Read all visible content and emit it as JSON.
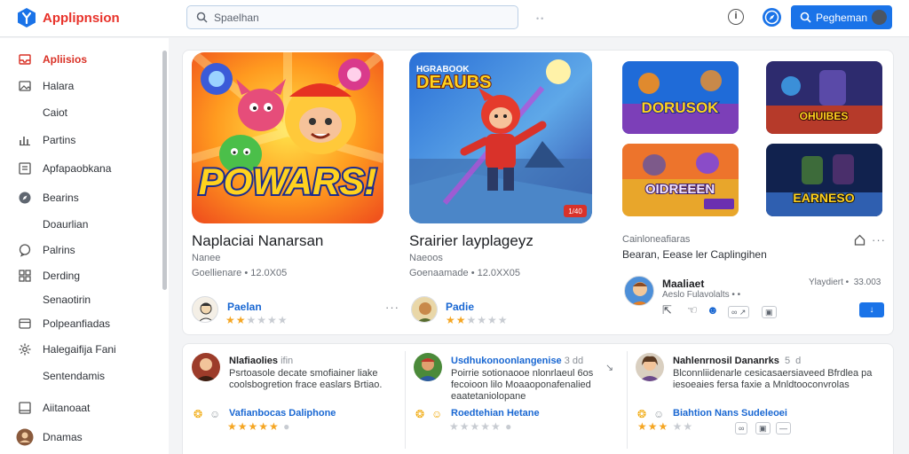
{
  "header": {
    "app_name": "Applipnsion",
    "search_placeholder": "Spaelhan",
    "primary_button": "Pegheman"
  },
  "sidebar": {
    "items": [
      {
        "label": "Apliisios",
        "icon": "inbox-icon",
        "active": true
      },
      {
        "label": "Halara",
        "icon": "image-icon"
      },
      {
        "label": "Caiot",
        "icon": ""
      },
      {
        "label": "Partins",
        "icon": "bar-chart-icon"
      },
      {
        "label": "Apfapaobkana",
        "icon": "document-icon"
      },
      {
        "label": "Bearins",
        "icon": "compass-icon"
      },
      {
        "label": "Doaurlian",
        "icon": ""
      },
      {
        "label": "Palrins",
        "icon": "chat-icon"
      },
      {
        "label": "Derding",
        "icon": "grid-icon"
      },
      {
        "label": "Senaotirin",
        "icon": ""
      },
      {
        "label": "Polpeanfiadas",
        "icon": "card-icon"
      },
      {
        "label": "Halegaifija Fani",
        "icon": "settings-icon"
      },
      {
        "label": "Sentendamis",
        "icon": ""
      },
      {
        "label": "Aiitanoaat",
        "icon": "layout-icon"
      },
      {
        "label": "Dnamas",
        "icon": "avatar-icon"
      }
    ]
  },
  "featured": [
    {
      "art_text": "POWARS!",
      "title": "Naplaciai Nanarsan",
      "subtitle": "Nanee",
      "meta": "Goellienare • 12.0X05",
      "developer": "Paelan",
      "rating": 2
    },
    {
      "art_text": "DEAUBS",
      "art_caption": "HGRABOOK",
      "badge": "1/40",
      "title": "Srairier layplageyz",
      "subtitle": "Naeoos",
      "meta": "Goenaamade • 12.0XX05",
      "developer": "Padie",
      "rating": 2
    }
  ],
  "thumbnails": [
    {
      "art_text": "DORUSOK"
    },
    {
      "art_text": "OHUIBES"
    },
    {
      "art_text": "OIDREEEN"
    },
    {
      "art_text": "EARNESO"
    }
  ],
  "side_panel": {
    "label": "Cainloneafiaras",
    "description": "Bearan, Eease ler Caplingihen",
    "developer_name": "Maaliaet",
    "developer_tags": "Aeslo Fulavolalts • •",
    "date": "Ylaydiert •  33.003"
  },
  "reviews": [
    {
      "name": "Nlafiaolies",
      "handle": "ifin",
      "text": "Psrtoasole decate smofiainer liake coolsbogretion frace easlars Brtiao.",
      "tag": "Vafianbocas Daliphone",
      "rating": 5
    },
    {
      "name": "Usdhukonoonlangenise",
      "handle": "3 dd",
      "text": "Poirrie sotionaooe nlonrlaeul 6os fecoioon lilo Moaaoponafenalied eaatetaniolopane",
      "tag": "Roedtehian Hetane",
      "rating": 0
    },
    {
      "name": "Nahlenrnosil Dananrks",
      "handle": " 5  d",
      "text": "Blconnliidenarle cesicasaersiaveed Bfrdlea pa iesoeaies fersa faxie a Mnldtooconvrolas",
      "tag": "Biahtion Nans Sudeleoei",
      "rating": 3
    }
  ],
  "colors": {
    "accent": "#1a73e8",
    "brand_red": "#e8322a",
    "star": "#f5a623"
  }
}
